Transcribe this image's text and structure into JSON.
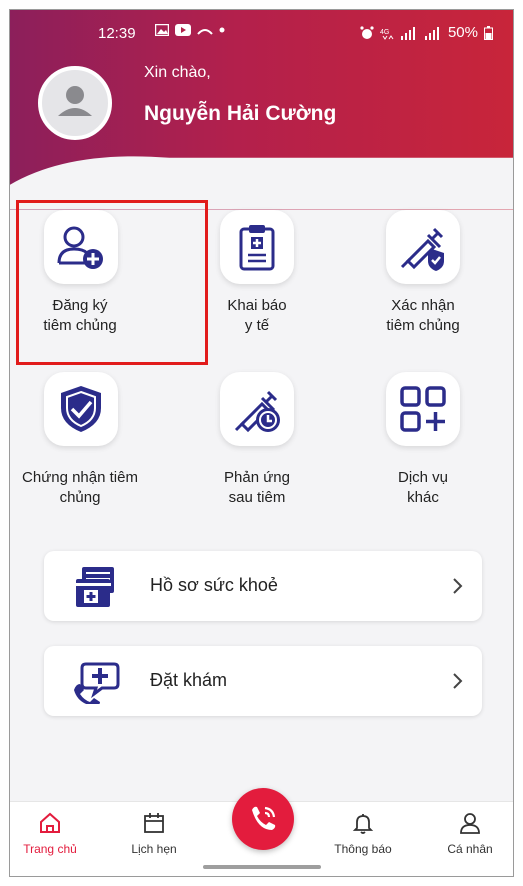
{
  "status_bar": {
    "time": "12:39",
    "battery": "50%"
  },
  "header": {
    "greeting": "Xin chào,",
    "user_name": "Nguyễn Hải Cường"
  },
  "services": [
    {
      "label_line1": "Đăng ký",
      "label_line2": "tiêm chủng",
      "icon": "add-user-icon"
    },
    {
      "label_line1": "Khai báo",
      "label_line2": "y tế",
      "icon": "clipboard-icon"
    },
    {
      "label_line1": "Xác nhận",
      "label_line2": "tiêm chủng",
      "icon": "syringe-shield-icon"
    },
    {
      "label_line1": "Chứng nhận tiêm",
      "label_line2": "chủng",
      "icon": "shield-check-icon"
    },
    {
      "label_line1": "Phản ứng",
      "label_line2": "sau tiêm",
      "icon": "syringe-clock-icon"
    },
    {
      "label_line1": "Dịch vụ",
      "label_line2": "khác",
      "icon": "grid-plus-icon"
    }
  ],
  "menu": [
    {
      "label": "Hồ sơ sức khoẻ",
      "icon": "health-record-icon"
    },
    {
      "label": "Đặt khám",
      "icon": "phone-medical-icon"
    }
  ],
  "bottom_nav": [
    {
      "label": "Trang chủ",
      "icon": "home-icon",
      "active": true
    },
    {
      "label": "Lịch hẹn",
      "icon": "calendar-icon",
      "active": false
    },
    {
      "label": "Thông báo",
      "icon": "bell-icon",
      "active": false
    },
    {
      "label": "Cá nhân",
      "icon": "person-icon",
      "active": false
    }
  ],
  "colors": {
    "primary": "#2b2c8a",
    "accent": "#e31c3d",
    "header_start": "#8c1f5b",
    "header_end": "#c8253a",
    "highlight_box": "#e11b1b"
  }
}
